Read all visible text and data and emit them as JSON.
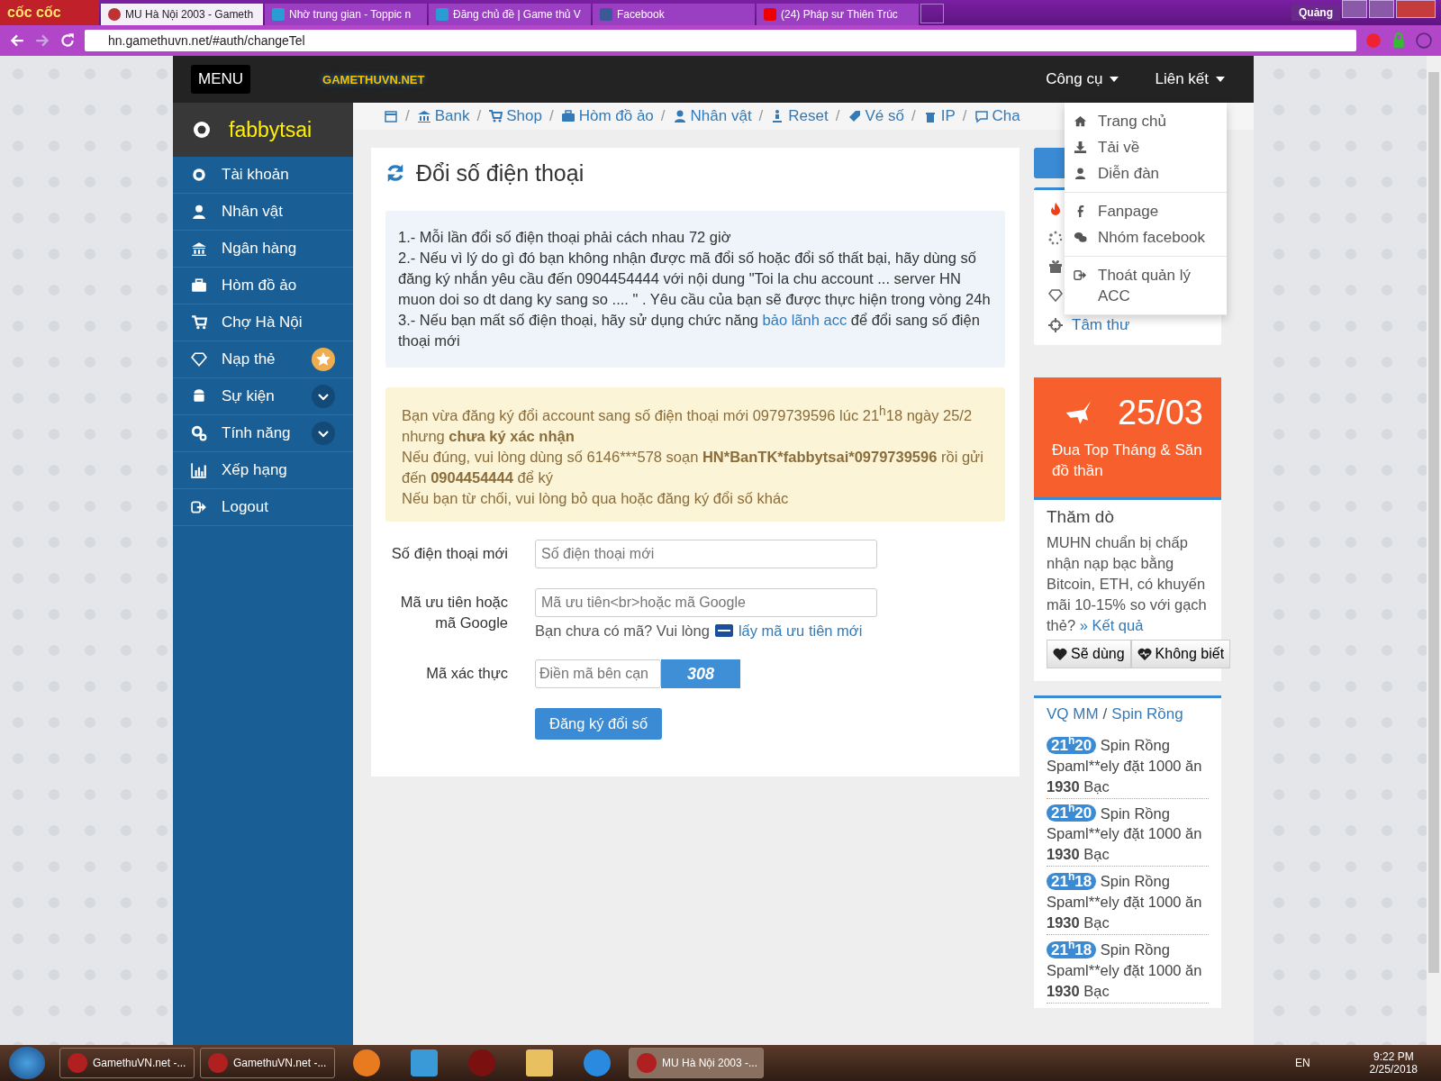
{
  "browser": {
    "brand": "cốc cốc",
    "tabs": [
      {
        "title": "MU Hà Nội 2003 - Gameth",
        "selected": true
      },
      {
        "title": "Nhờ trung gian - Toppic n",
        "selected": false
      },
      {
        "title": "Đăng chủ đề | Game thủ V",
        "selected": false
      },
      {
        "title": "Facebook",
        "selected": false
      },
      {
        "title": "(24) Pháp sư Thiên Trúc",
        "selected": false
      }
    ],
    "profile": "Quảng",
    "url": "hn.gamethuvn.net/#auth/changeTel"
  },
  "header": {
    "menu_button": "MENU",
    "logo": "GAMETHUVN.NET",
    "nav": [
      "Công cụ",
      "Liên kết"
    ]
  },
  "sidebar": {
    "username": "fabbytsai",
    "items": [
      {
        "label": "Tài khoản",
        "kind": "plain"
      },
      {
        "label": "Nhân vật",
        "kind": "plain"
      },
      {
        "label": "Ngân hàng",
        "kind": "plain"
      },
      {
        "label": "Hòm đồ ảo",
        "kind": "plain"
      },
      {
        "label": "Chợ Hà Nội",
        "kind": "plain"
      },
      {
        "label": "Nạp thẻ",
        "kind": "star"
      },
      {
        "label": "Sự kiện",
        "kind": "chevron"
      },
      {
        "label": "Tính năng",
        "kind": "chevron"
      },
      {
        "label": "Xếp hạng",
        "kind": "plain"
      },
      {
        "label": "Logout",
        "kind": "plain"
      }
    ]
  },
  "breadcrumb": [
    {
      "separator": "/",
      "label": "Bank"
    },
    {
      "separator": "/",
      "label": "Shop"
    },
    {
      "separator": "/",
      "label": "Hòm đồ ảo"
    },
    {
      "separator": "/",
      "label": "Nhân vật"
    },
    {
      "separator": "/",
      "label": "Reset"
    },
    {
      "separator": "/",
      "label": "Vé số"
    },
    {
      "separator": "/",
      "label": "IP"
    },
    {
      "separator": "/",
      "label": "Cha"
    }
  ],
  "main": {
    "title": "Đổi số điện thoại",
    "notes": [
      "1.- Mỗi lần đổi số điện thoại phải cách nhau 72 giờ",
      "2.- Nếu vì lý do gì đó bạn không nhận được mã đổi số hoặc đổi số thất bại, hãy dùng số đăng ký nhắn yêu cầu đến 0904454444 với nội dung \"Toi la chu account ... server HN muon doi so dt dang ky sang so .... \" . Yêu cầu của bạn sẽ được thực hiện trong vòng 24h"
    ],
    "note3": {
      "before": "3.- Nếu bạn mất số điện thoại, hãy sử dụng chức năng",
      "link": "bảo lãnh acc",
      "after": "để đổi sang số điện thoại mới"
    },
    "alert": [
      [
        {
          "text": "Bạn vừa đăng ký đổi account sang số điện thoại mới 0979739596 lúc 21$^{h}$18 ngày 25/2 nhưng ",
          "bold": false
        },
        {
          "text": "chưa ký xác nhận",
          "bold": true
        }
      ],
      [
        {
          "text": "Nếu đúng, vui lòng dùng số 6146***578 soạn ",
          "bold": false
        },
        {
          "text": "HN*BanTK*fabbytsai*0979739596",
          "bold": true
        },
        {
          "text": " rồi gửi đến ",
          "bold": false
        },
        {
          "text": "0904454444",
          "bold": true
        },
        {
          "text": " để ký",
          "bold": false
        }
      ],
      [
        {
          "text": "Nếu bạn từ chối, vui lòng bỏ qua hoặc đăng ký đổi số khác",
          "bold": false
        }
      ]
    ],
    "fields": [
      {
        "label": "Số điện thoại mới",
        "placeholder": "Số điện thoại mới"
      },
      {
        "label": "Mã ưu tiên hoặc mã Google",
        "placeholder": "Mã ưu tiên<br>hoặc mã Google"
      },
      {
        "label": "Mã xác thực",
        "placeholder": "Điền mã bên cạn"
      }
    ],
    "help": {
      "text": "Bạn chưa có mã? Vui lòng",
      "link": "lấy mã ưu tiên mới"
    },
    "captcha": "308",
    "submit": "Đăng ký đổi số"
  },
  "dropdown": [
    [
      "Trang chủ",
      "Tải về",
      "Diễn đàn"
    ],
    [
      "Fanpage",
      "Nhóm facebook"
    ],
    [
      "Thoát quản lý ACC"
    ]
  ],
  "right": {
    "list_link": "Tâm thư",
    "event": {
      "date": "25/03",
      "text": "Đua Top Tháng & Săn đồ thần"
    },
    "poll": {
      "title": "Thăm dò",
      "question": "MUHN chuẩn bị chấp nhận nạp bạc bằng Bitcoin, ETH, có khuyến mãi 10-15% so với gạch thẻ?",
      "link": "» Kết quả",
      "buttons": [
        "Sẽ dùng",
        "Không biết"
      ]
    },
    "feed": {
      "links": [
        "VQ MM",
        "Spin Rồng"
      ],
      "separator": "/",
      "entries": [
        {
          "time": "21$^{h}$20",
          "game": "Spin Rồng",
          "text": "Spaml**ely đặt 1000 ăn",
          "amount": "1930",
          "unit": "Bạc"
        },
        {
          "time": "21$^{h}$20",
          "game": "Spin Rồng",
          "text": "Spaml**ely đặt 1000 ăn",
          "amount": "1930",
          "unit": "Bạc"
        },
        {
          "time": "21$^{h}$18",
          "game": "Spin Rồng",
          "text": "Spaml**ely đặt 1000 ăn",
          "amount": "1930",
          "unit": "Bạc"
        },
        {
          "time": "21$^{h}$18",
          "game": "Spin Rồng",
          "text": "Spaml**ely đặt 1000 ăn",
          "amount": "1930",
          "unit": "Bạc"
        }
      ]
    }
  },
  "taskbar": {
    "windows": [
      {
        "title": "GamethuVN.net -...",
        "selected": false
      },
      {
        "title": "GamethuVN.net -...",
        "selected": false
      },
      {
        "title": "MU Hà Nội 2003 -...",
        "selected": true
      }
    ],
    "lang": "EN",
    "time": "9:22 PM",
    "date": "2/25/2018"
  }
}
